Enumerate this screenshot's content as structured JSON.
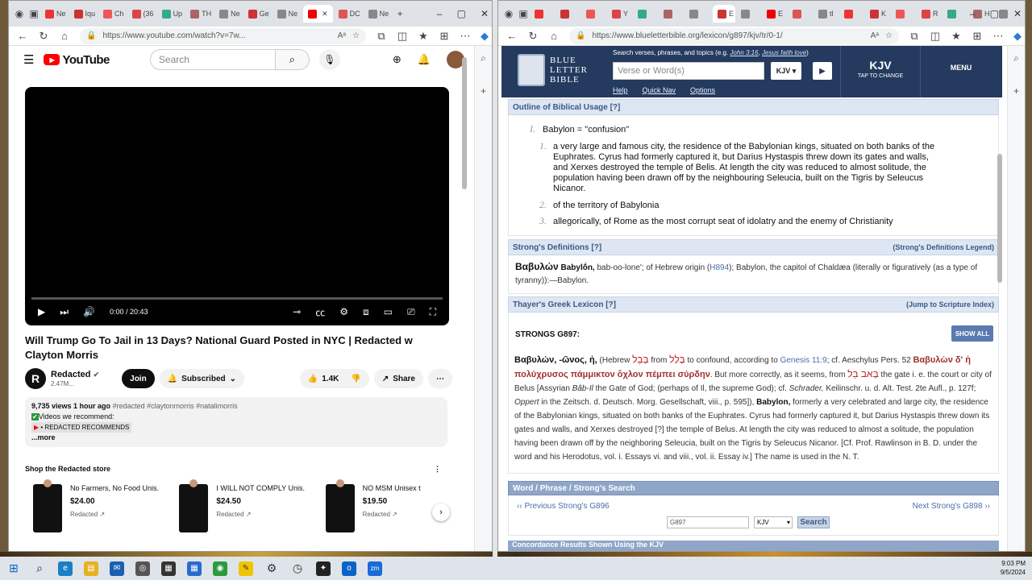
{
  "left_browser": {
    "tabs": [
      "Ne",
      "Iqu",
      "Ch",
      "(36",
      "Up",
      "TH",
      "Ne",
      "Ge",
      "Ne",
      "",
      "DC",
      "Ne"
    ],
    "url": "https://www.youtube.com/watch?v=7w..."
  },
  "youtube": {
    "logo": "YouTube",
    "search_placeholder": "Search",
    "time": "0:00 / 20:43",
    "title": "Will Trump Go To Jail in 13 Days? National Guard Posted in NYC | Redacted w Clayton Morris",
    "channel": "Redacted",
    "channel_avatar": "R",
    "subscribers": "2.47M...",
    "join": "Join",
    "subscribed": "Subscribed",
    "likes": "1.4K",
    "share": "Share",
    "desc_meta": "9,735 views  1 hour ago",
    "desc_tags": "#redacted #claytonmorris #natalimorris",
    "desc_line2": "Videos we recommend:",
    "desc_rec": "• REDACTED RECOMMENDS",
    "desc_more": "...more",
    "shop_title": "Shop the Redacted store",
    "products": [
      {
        "name": "No Farmers, No Food Unis...",
        "price": "$24.00",
        "seller": "Redacted"
      },
      {
        "name": "I WILL NOT COMPLY Unis...",
        "price": "$24.50",
        "seller": "Redacted"
      },
      {
        "name": "NO MSM Unisex t",
        "price": "$19.50",
        "seller": "Redacted"
      }
    ]
  },
  "right_browser": {
    "tabs": [
      "",
      "",
      "",
      "Y",
      "",
      "",
      "",
      "E",
      "",
      "E",
      "",
      "tl",
      "",
      "K",
      "",
      "R",
      "",
      "H",
      "",
      "",
      "D",
      ""
    ],
    "url": "https://www.blueletterbible.org/lexicon/g897/kjv/tr/0-1/"
  },
  "blb": {
    "logo_lines": [
      "BLUE",
      "LETTER",
      "BIBLE"
    ],
    "search_hint": "Search verses, phrases, and topics (e.g.",
    "search_ex1": "John 3:16",
    "search_ex2": "Jesus faith love",
    "search_placeholder": "Verse or Word(s)",
    "version": "KJV",
    "links": [
      "Help",
      "Quick Nav",
      "Options"
    ],
    "kjv": "KJV",
    "kjv_tap": "TAP TO CHANGE",
    "menu": "MENU",
    "obu_title": "Outline of Biblical Usage [?]",
    "obu_main_num": "I.",
    "obu_main": "Babylon = \"confusion\"",
    "obu_items": [
      {
        "num": "1.",
        "lines": [
          "a very large and famous city, the residence of the Babylonian kings, situated on both banks of the",
          "Euphrates. Cyrus had formerly captured it, but Darius Hystaspis threw down its gates and walls,",
          "and Xerxes destroyed the temple of Belis. At length the city was reduced to almost solitude, the",
          "population having been drawn off by the neighbouring Seleucia, built on the Tigris by Seleucus",
          "Nicanor."
        ]
      },
      {
        "num": "2.",
        "lines": [
          "of the territory of Babylonia"
        ]
      },
      {
        "num": "3.",
        "lines": [
          "allegorically, of Rome as the most corrupt seat of idolatry and the enemy of Christianity"
        ]
      }
    ],
    "sd_title": "Strong's Definitions [?]",
    "sd_legend": "(Strong's Definitions Legend)",
    "sd_greek": "Βαβυλών",
    "sd_translit": "Babylṓn,",
    "sd_text1": "bab-oo-lone'; of Hebrew origin (",
    "sd_link": "H894",
    "sd_text2": "); Babylon, the capitol of Chaldæa (literally or figuratively (as a type of tyranny)):—Babylon.",
    "thayer_title": "Thayer's Greek Lexicon [?]",
    "thayer_jump": "(Jump to Scripture Index)",
    "strongs_head": "STRONGS G897:",
    "show_all": "SHOW ALL",
    "tg_greek": "Βαβυλών, -ῶνος, ἡ,",
    "tg_a": "(Hebrew",
    "tg_heb1": "בָּבֶל",
    "tg_from": "from",
    "tg_heb2": "בָּלַל",
    "tg_b": "to confound, according to",
    "tg_link": "Genesis 11:9",
    "tg_c": "; cf. Aeschylus Pers. 52",
    "tg_greek2": "Βαβυλὼν δ' ἡ πολύχρυσος πάμμικτον ὄχλον πέμπει σύρδην",
    "tg_d": ". But more correctly, as it seems, from",
    "tg_heb3": "בָּאב בֵּל",
    "tg_e": "the gate i. e. the court or city of Belus [Assyrian",
    "tg_bab": "Bâb-Il",
    "tg_f": "the Gate of God; (perhaps of Il, the supreme God); cf.",
    "tg_schr": "Schrader,",
    "tg_g": "Keilinschr. u. d. Alt. Test. 2te Aufl., p. 127f;",
    "tg_opp": "Oppert",
    "tg_h": "in the Zeitsch. d. Deutsch. Morg. Gesellschaft, viii., p. 595]),",
    "tg_bab2": "Babylon,",
    "tg_i": "formerly a very celebrated and large city, the residence of the Babylonian kings, situated on both banks of the Euphrates. Cyrus had formerly captured it, but Darius Hystaspis threw down its gates and walls, and Xerxes destroyed [?] the temple of Belus. At length the city was reduced to almost a solitude, the population having been drawn off by the neighboring Seleucia, built on the Tigris by Seleucus Nicanor. [Cf. Prof. Rawlinson in B. D. under the word and his Herodotus, vol. i. Essays vi. and viii., vol. ii. Essay iv.] The name is used in the N. T.",
    "wps_title": "Word / Phrase / Strong's Search",
    "prev": "‹‹ Previous Strong's G896",
    "next": "Next Strong's G898 ››",
    "search_value": "G897",
    "search_version": "KJV",
    "search_btn": "Search",
    "concord": "Concordance Results Shown Using the KJV"
  },
  "taskbar": {
    "time": "9:03 PM",
    "date": "9/5/2024",
    "zm": "zm"
  }
}
